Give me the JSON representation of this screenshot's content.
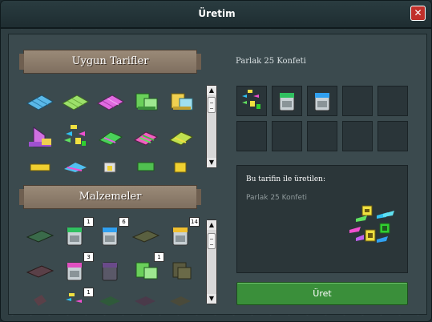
{
  "window": {
    "title": "Üretim",
    "close_label": "✕"
  },
  "recipes_panel": {
    "title": "Uygun Tarifler"
  },
  "materials_panel": {
    "title": "Malzemeler"
  },
  "recipe": {
    "name": "Parlak 25 Konfeti",
    "produced_heading": "Bu tarifin ile üretilen:",
    "produced_name": "Parlak 25 Konfeti"
  },
  "ingredient_slots": [
    {
      "item": "confetti-icon"
    },
    {
      "item": "paint-bucket-green-icon"
    },
    {
      "item": "paint-bucket-blue-icon"
    },
    {
      "item": "empty"
    },
    {
      "item": "empty"
    },
    {
      "item": "empty"
    },
    {
      "item": "empty"
    },
    {
      "item": "empty"
    },
    {
      "item": "empty"
    },
    {
      "item": "empty"
    }
  ],
  "materials": [
    {
      "item": "green-mat-icon",
      "count": ""
    },
    {
      "item": "paint-bucket-green-icon",
      "count": "1"
    },
    {
      "item": "paint-bucket-blue-icon",
      "count": "6"
    },
    {
      "item": "olive-mat-icon",
      "count": ""
    },
    {
      "item": "paint-bucket-yellow-icon",
      "count": "14"
    },
    {
      "item": "pink-mat-icon",
      "count": ""
    },
    {
      "item": "paint-bucket-pink-icon",
      "count": "3"
    },
    {
      "item": "paint-bucket-purple-icon",
      "count": ""
    },
    {
      "item": "green-sofa-icon",
      "count": "1"
    },
    {
      "item": "olive-chair-icon",
      "count": ""
    },
    {
      "item": "pink-rug-icon",
      "count": ""
    },
    {
      "item": "confetti-icon",
      "count": "1"
    },
    {
      "item": "green-stripe-icon",
      "count": ""
    },
    {
      "item": "purple-mat-icon",
      "count": ""
    },
    {
      "item": "olive-stripe-icon",
      "count": ""
    }
  ],
  "produce_button": {
    "label": "Üret"
  },
  "colors": {
    "produce": "#3a8f3a",
    "close": "#c0302a",
    "banner": "#8f7f6f"
  }
}
